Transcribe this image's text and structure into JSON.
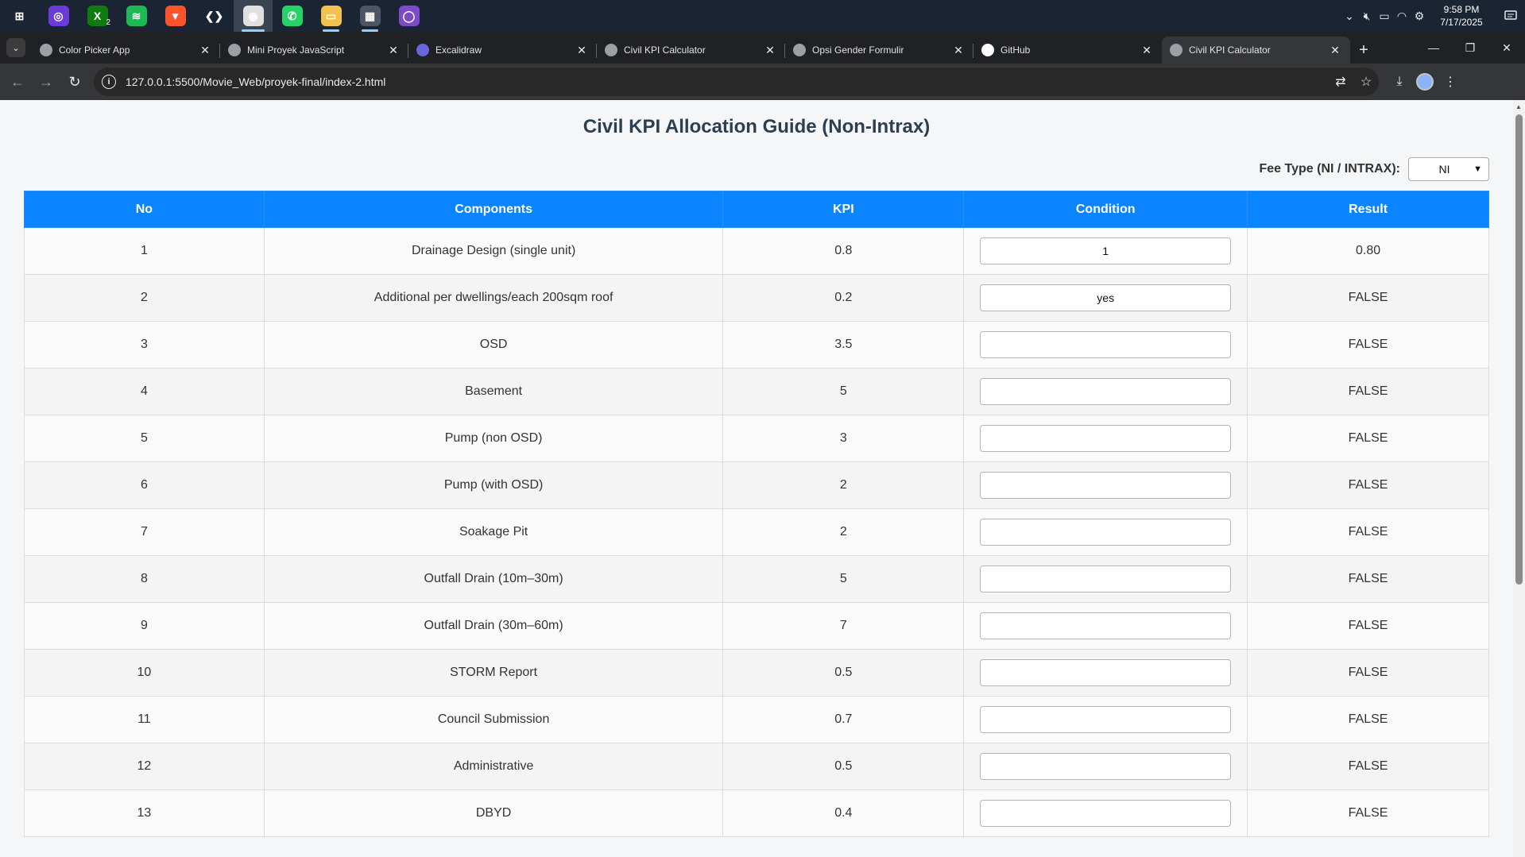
{
  "taskbar": {
    "apps": [
      {
        "name": "windows-start-icon",
        "color": "#1b2433",
        "glyph": "⊞",
        "running": false,
        "active": false
      },
      {
        "name": "instagram-icon",
        "color": "#6a3bd8",
        "glyph": "◎",
        "running": false,
        "active": false
      },
      {
        "name": "xbox-icon",
        "color": "#107c10",
        "glyph": "X",
        "running": false,
        "active": false
      },
      {
        "name": "spotify-icon",
        "color": "#1db954",
        "glyph": "≋",
        "running": false,
        "active": false
      },
      {
        "name": "brave-browser-icon",
        "color": "#fb542b",
        "glyph": "▼",
        "running": false,
        "active": false
      },
      {
        "name": "vscode-icon",
        "color": "#1b2433",
        "glyph": "❮❯",
        "running": false,
        "active": false
      },
      {
        "name": "chrome-icon",
        "color": "#e0e0e0",
        "glyph": "◉",
        "running": true,
        "active": true
      },
      {
        "name": "whatsapp-icon",
        "color": "#25d366",
        "glyph": "✆",
        "running": false,
        "active": false
      },
      {
        "name": "file-explorer-icon",
        "color": "#f2c14e",
        "glyph": "▭",
        "running": true,
        "active": false
      },
      {
        "name": "calculator-icon",
        "color": "#4c5566",
        "glyph": "▦",
        "running": true,
        "active": false
      },
      {
        "name": "github-desktop-icon",
        "color": "#7d4bc9",
        "glyph": "◯",
        "running": false,
        "active": false
      }
    ],
    "xbox_badge": "2",
    "clock_time": "9:58 PM",
    "clock_date": "7/17/2025"
  },
  "tabs": [
    {
      "title": "Color Picker App",
      "favicon_color": "#9aa0a6",
      "active": false
    },
    {
      "title": "Mini Proyek JavaScript",
      "favicon_color": "#9aa0a6",
      "active": false
    },
    {
      "title": "Excalidraw",
      "favicon_color": "#6965db",
      "active": false
    },
    {
      "title": "Civil KPI Calculator",
      "favicon_color": "#9aa0a6",
      "active": false
    },
    {
      "title": "Opsi Gender Formulir",
      "favicon_color": "#9aa0a6",
      "active": false
    },
    {
      "title": "GitHub",
      "favicon_color": "#ffffff",
      "active": false
    },
    {
      "title": "Civil KPI Calculator",
      "favicon_color": "#9aa0a6",
      "active": true
    }
  ],
  "address_bar": {
    "url": "127.0.0.1:5500/Movie_Web/proyek-final/index-2.html"
  },
  "page": {
    "title": "Civil KPI Allocation Guide (Non-Intrax)",
    "fee_type_label": "Fee Type (NI / INTRAX):",
    "fee_type_value": "NI",
    "columns": [
      "No",
      "Components",
      "KPI",
      "Condition",
      "Result"
    ],
    "rows": [
      {
        "no": "1",
        "component": "Drainage Design (single unit)",
        "kpi": "0.8",
        "condition": "1",
        "result": "0.80"
      },
      {
        "no": "2",
        "component": "Additional per dwellings/each 200sqm roof",
        "kpi": "0.2",
        "condition": "yes",
        "result": "FALSE"
      },
      {
        "no": "3",
        "component": "OSD",
        "kpi": "3.5",
        "condition": "",
        "result": "FALSE"
      },
      {
        "no": "4",
        "component": "Basement",
        "kpi": "5",
        "condition": "",
        "result": "FALSE"
      },
      {
        "no": "5",
        "component": "Pump (non OSD)",
        "kpi": "3",
        "condition": "",
        "result": "FALSE"
      },
      {
        "no": "6",
        "component": "Pump (with OSD)",
        "kpi": "2",
        "condition": "",
        "result": "FALSE"
      },
      {
        "no": "7",
        "component": "Soakage Pit",
        "kpi": "2",
        "condition": "",
        "result": "FALSE"
      },
      {
        "no": "8",
        "component": "Outfall Drain (10m–30m)",
        "kpi": "5",
        "condition": "",
        "result": "FALSE"
      },
      {
        "no": "9",
        "component": "Outfall Drain (30m–60m)",
        "kpi": "7",
        "condition": "",
        "result": "FALSE"
      },
      {
        "no": "10",
        "component": "STORM Report",
        "kpi": "0.5",
        "condition": "",
        "result": "FALSE"
      },
      {
        "no": "11",
        "component": "Council Submission",
        "kpi": "0.7",
        "condition": "",
        "result": "FALSE"
      },
      {
        "no": "12",
        "component": "Administrative",
        "kpi": "0.5",
        "condition": "",
        "result": "FALSE"
      },
      {
        "no": "13",
        "component": "DBYD",
        "kpi": "0.4",
        "condition": "",
        "result": "FALSE"
      }
    ]
  },
  "colors": {
    "header_blue": "#0a84ff",
    "title_text": "#2c3e50"
  }
}
